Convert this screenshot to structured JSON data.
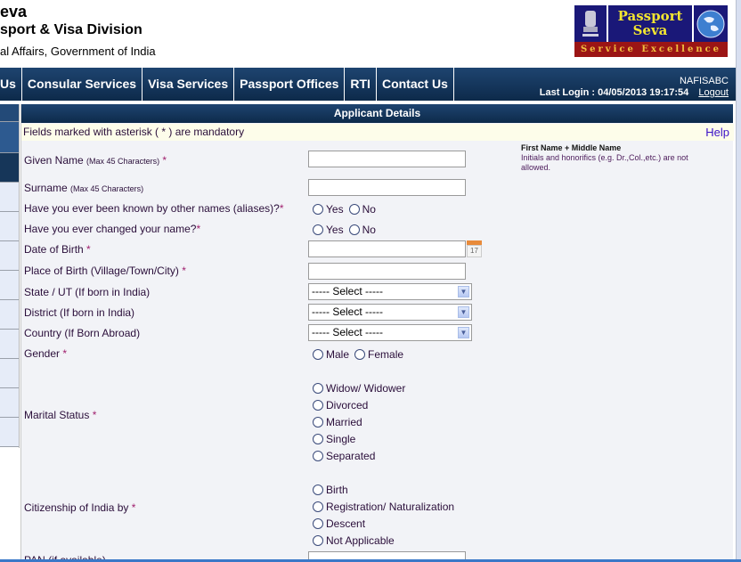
{
  "header": {
    "title_line1": "eva",
    "title_line2": "sport & Visa Division",
    "title_line3": "al Affairs, Government of India",
    "logo": {
      "line1": "Passport",
      "line2": "Seva",
      "tagline": "Service Excellence",
      "emblem_icon": "national-emblem-icon",
      "globe_icon": "globe-icon"
    }
  },
  "nav": {
    "items": [
      {
        "label": "Us"
      },
      {
        "label": "Consular Services"
      },
      {
        "label": "Visa Services"
      },
      {
        "label": "Passport Offices"
      },
      {
        "label": "RTI"
      },
      {
        "label": "Contact Us"
      }
    ],
    "username": "NAFISABC",
    "last_login_label": "Last Login :",
    "last_login_value": "04/05/2013 19:17:54",
    "logout": "Logout"
  },
  "section": {
    "title": "Applicant Details",
    "mandatory_note": "Fields marked with asterisk ( * ) are mandatory",
    "help": "Help"
  },
  "hint": {
    "title": "First Name + Middle Name",
    "text": "Initials and honorifics (e.g. Dr.,Col.,etc.) are not allowed."
  },
  "form": {
    "given_name": {
      "label": "Given Name",
      "sub": "(Max 45 Characters)",
      "req": "*",
      "value": ""
    },
    "surname": {
      "label": "Surname",
      "sub": "(Max 45 Characters)",
      "value": ""
    },
    "aliases": {
      "label": "Have you ever been known by other names (aliases)?",
      "req": "*",
      "options": [
        "Yes",
        "No"
      ]
    },
    "changed_name": {
      "label": "Have you ever changed your name?",
      "req": "*",
      "options": [
        "Yes",
        "No"
      ]
    },
    "dob": {
      "label": "Date of Birth",
      "req": "*",
      "value": "",
      "calendar_day": "17"
    },
    "place_of_birth": {
      "label": "Place of Birth (Village/Town/City)",
      "req": "*",
      "value": ""
    },
    "state": {
      "label": "State / UT (If born in India)",
      "selected": "----- Select -----"
    },
    "district": {
      "label": "District (If born in India)",
      "selected": "----- Select -----"
    },
    "country": {
      "label": "Country (If Born Abroad)",
      "selected": "----- Select -----"
    },
    "gender": {
      "label": "Gender",
      "req": "*",
      "options": [
        "Male",
        "Female"
      ]
    },
    "marital": {
      "label": "Marital Status",
      "req": "*",
      "options": [
        "Widow/ Widower",
        "Divorced",
        "Married",
        "Single",
        "Separated"
      ]
    },
    "citizenship": {
      "label": "Citizenship of India by",
      "req": "*",
      "options": [
        "Birth",
        "Registration/ Naturalization",
        "Descent",
        "Not Applicable"
      ]
    },
    "pan": {
      "label": "PAN (if available)",
      "value": ""
    }
  }
}
